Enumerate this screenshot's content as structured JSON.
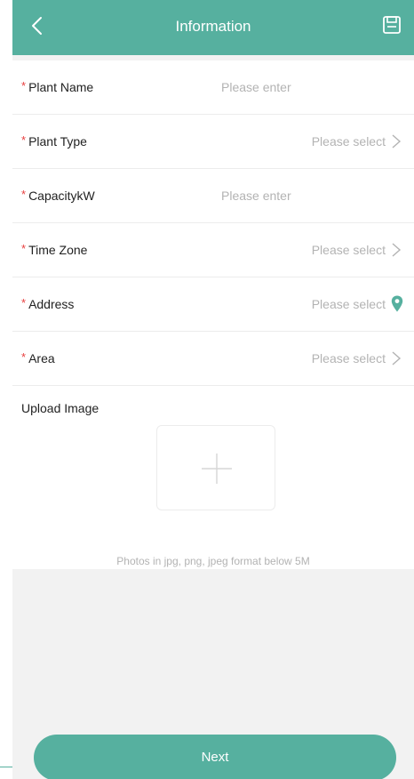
{
  "header": {
    "title": "Information",
    "back_icon": "chevron-left-icon",
    "save_icon": "save-icon"
  },
  "colors": {
    "primary": "#56b09f",
    "required": "#e84040",
    "placeholder": "#b3b3b3",
    "background": "#f2f2f2"
  },
  "form": {
    "required_mark": "*",
    "fields": [
      {
        "label": "Plant Name",
        "placeholder": "Please enter",
        "kind": "input"
      },
      {
        "label": "Plant Type",
        "placeholder": "Please select",
        "kind": "select"
      },
      {
        "label": "CapacitykW",
        "placeholder": "Please enter",
        "kind": "input"
      },
      {
        "label": "Time Zone",
        "placeholder": "Please select",
        "kind": "select"
      },
      {
        "label": "Address",
        "placeholder": "Please select",
        "kind": "location"
      },
      {
        "label": "Area",
        "placeholder": "Please select",
        "kind": "select"
      }
    ],
    "upload": {
      "label": "Upload Image",
      "icon": "plus-icon",
      "hint": "Photos in jpg, png, jpeg format below 5M"
    }
  },
  "footer": {
    "next_label": "Next"
  }
}
